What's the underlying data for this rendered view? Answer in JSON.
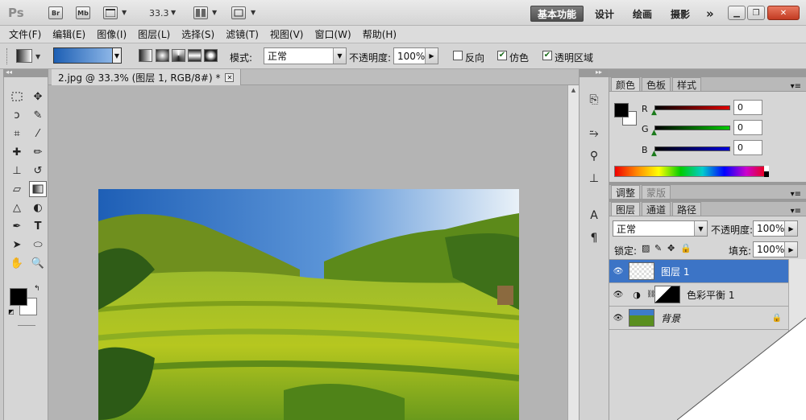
{
  "appbar": {
    "logo": "Ps",
    "bridge_label": "Br",
    "minibridge_label": "Mb",
    "zoom": "33.3",
    "workspaces": [
      "基本功能",
      "设计",
      "绘画",
      "摄影"
    ],
    "more": "»"
  },
  "menu": [
    "文件(F)",
    "编辑(E)",
    "图像(I)",
    "图层(L)",
    "选择(S)",
    "滤镜(T)",
    "视图(V)",
    "窗口(W)",
    "帮助(H)"
  ],
  "options": {
    "mode_label": "模式:",
    "mode_value": "正常",
    "opacity_label": "不透明度:",
    "opacity_value": "100%",
    "reverse_label": "反向",
    "dither_label": "仿色",
    "transparency_label": "透明区域"
  },
  "document": {
    "tab_title": "2.jpg @ 33.3% (图层 1, RGB/8#) *"
  },
  "color_panel": {
    "tabs": [
      "颜色",
      "色板",
      "样式"
    ],
    "channels": [
      {
        "label": "R",
        "value": "0",
        "color": "#c81818"
      },
      {
        "label": "G",
        "value": "0",
        "color": "#1aa31a"
      },
      {
        "label": "B",
        "value": "0",
        "color": "#1a1ab5"
      }
    ]
  },
  "adjust_panel": {
    "tabs": [
      "调整",
      "蒙版"
    ]
  },
  "layers_panel": {
    "tabs": [
      "图层",
      "通道",
      "路径"
    ],
    "blend_mode": "正常",
    "opacity_label": "不透明度:",
    "opacity_value": "100%",
    "lock_label": "锁定:",
    "fill_label": "填充:",
    "fill_value": "100%",
    "layers": [
      {
        "name": "图层 1",
        "selected": true
      },
      {
        "name": "色彩平衡 1",
        "selected": false
      },
      {
        "name": "背景",
        "selected": false
      }
    ]
  },
  "colors": {
    "accent": "#3c74c6",
    "foreground": "#000000",
    "background": "#ffffff"
  }
}
